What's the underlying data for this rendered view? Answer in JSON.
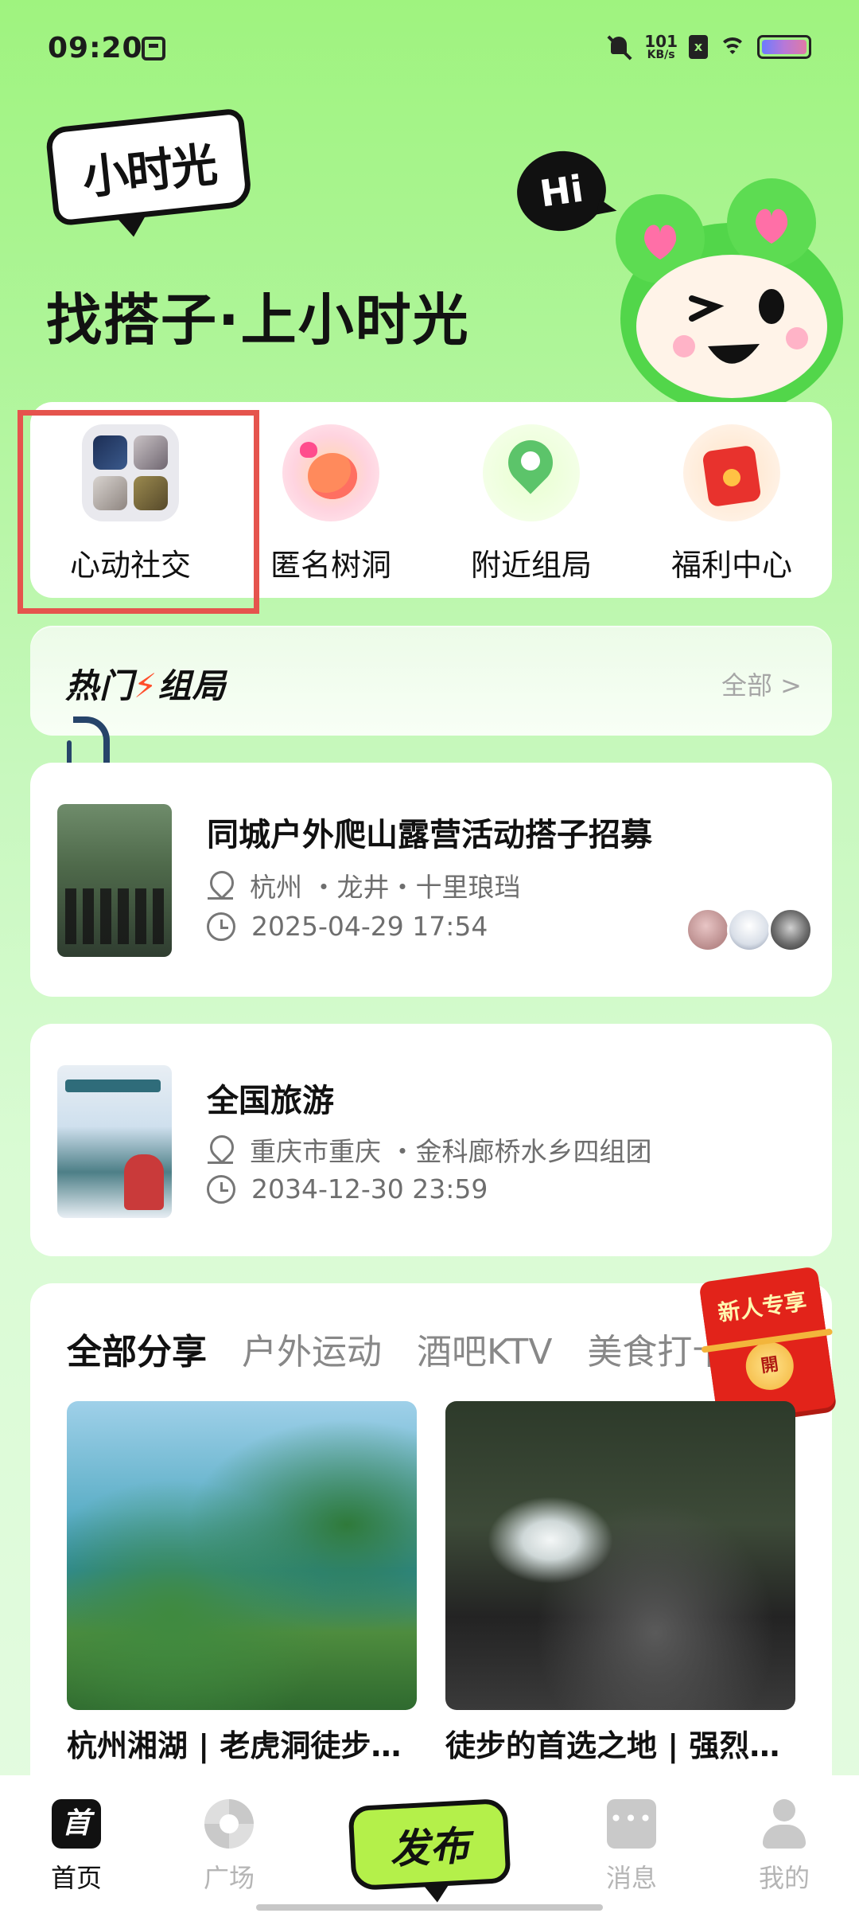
{
  "status_bar": {
    "time": "09:20",
    "net_speed_value": "101",
    "net_speed_unit": "KB/s",
    "sim_label": "x",
    "icons": [
      "notification-icon",
      "mute-icon",
      "sim-icon",
      "wifi-icon",
      "battery-icon"
    ]
  },
  "header": {
    "logo": "小时光",
    "slogan": "找搭子·上小时光",
    "hi_bubble": "Hi"
  },
  "shortcuts": [
    {
      "label": "心动社交",
      "icon": "social-icon"
    },
    {
      "label": "匿名树洞",
      "icon": "treehole-icon"
    },
    {
      "label": "附近组局",
      "icon": "nearby-icon"
    },
    {
      "label": "福利中心",
      "icon": "welfare-icon"
    }
  ],
  "hot_section": {
    "title_left": "热门",
    "title_right": "组局",
    "more": "全部 >"
  },
  "events": [
    {
      "title": "同城户外爬山露营活动搭子招募",
      "location": "杭州 ・龙井・十里琅珰",
      "time": "2025-04-29 17:54"
    },
    {
      "title": "全国旅游",
      "location": "重庆市重庆 ・金科廊桥水乡四组团",
      "time": "2034-12-30 23:59"
    }
  ],
  "share": {
    "tabs": [
      "全部分享",
      "户外运动",
      "酒吧KTV",
      "美食打卡"
    ],
    "active_tab": 0,
    "new_user_badge": "新人专享",
    "new_user_seal": "開",
    "posts": [
      {
        "caption": "杭州湘湖 | 老虎洞徒步路线攻略"
      },
      {
        "caption": "徒步的首选之地 | 强烈推荐"
      }
    ]
  },
  "bottom_nav": {
    "items": [
      {
        "label": "首页",
        "icon": "home-icon",
        "icon_text": "首"
      },
      {
        "label": "广场",
        "icon": "square-icon"
      },
      {
        "label": "消息",
        "icon": "message-icon"
      },
      {
        "label": "我的",
        "icon": "profile-icon"
      }
    ],
    "publish": "发布"
  },
  "colors": {
    "background_top": "#9ff37f",
    "accent_green": "#b4f04a",
    "highlight_red": "#e5544d",
    "badge_red": "#e2231a"
  }
}
